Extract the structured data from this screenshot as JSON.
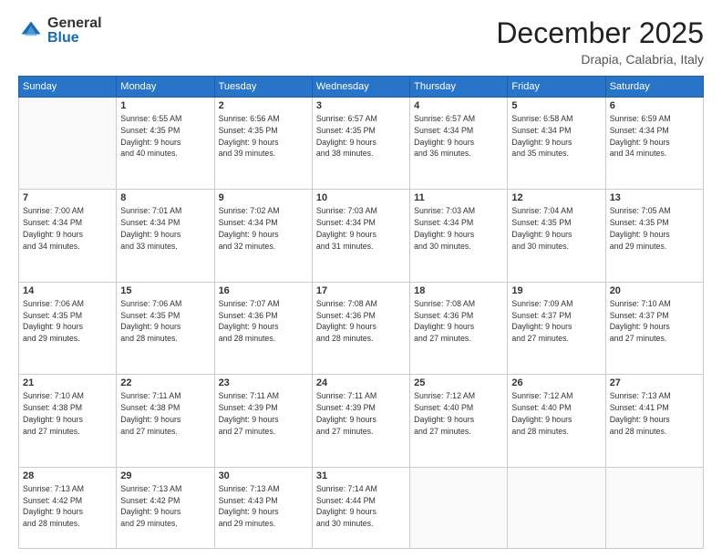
{
  "header": {
    "logo_general": "General",
    "logo_blue": "Blue",
    "month_title": "December 2025",
    "location": "Drapia, Calabria, Italy"
  },
  "days_of_week": [
    "Sunday",
    "Monday",
    "Tuesday",
    "Wednesday",
    "Thursday",
    "Friday",
    "Saturday"
  ],
  "weeks": [
    [
      {
        "day": "",
        "info": ""
      },
      {
        "day": "1",
        "info": "Sunrise: 6:55 AM\nSunset: 4:35 PM\nDaylight: 9 hours\nand 40 minutes."
      },
      {
        "day": "2",
        "info": "Sunrise: 6:56 AM\nSunset: 4:35 PM\nDaylight: 9 hours\nand 39 minutes."
      },
      {
        "day": "3",
        "info": "Sunrise: 6:57 AM\nSunset: 4:35 PM\nDaylight: 9 hours\nand 38 minutes."
      },
      {
        "day": "4",
        "info": "Sunrise: 6:57 AM\nSunset: 4:34 PM\nDaylight: 9 hours\nand 36 minutes."
      },
      {
        "day": "5",
        "info": "Sunrise: 6:58 AM\nSunset: 4:34 PM\nDaylight: 9 hours\nand 35 minutes."
      },
      {
        "day": "6",
        "info": "Sunrise: 6:59 AM\nSunset: 4:34 PM\nDaylight: 9 hours\nand 34 minutes."
      }
    ],
    [
      {
        "day": "7",
        "info": "Sunrise: 7:00 AM\nSunset: 4:34 PM\nDaylight: 9 hours\nand 34 minutes."
      },
      {
        "day": "8",
        "info": "Sunrise: 7:01 AM\nSunset: 4:34 PM\nDaylight: 9 hours\nand 33 minutes."
      },
      {
        "day": "9",
        "info": "Sunrise: 7:02 AM\nSunset: 4:34 PM\nDaylight: 9 hours\nand 32 minutes."
      },
      {
        "day": "10",
        "info": "Sunrise: 7:03 AM\nSunset: 4:34 PM\nDaylight: 9 hours\nand 31 minutes."
      },
      {
        "day": "11",
        "info": "Sunrise: 7:03 AM\nSunset: 4:34 PM\nDaylight: 9 hours\nand 30 minutes."
      },
      {
        "day": "12",
        "info": "Sunrise: 7:04 AM\nSunset: 4:35 PM\nDaylight: 9 hours\nand 30 minutes."
      },
      {
        "day": "13",
        "info": "Sunrise: 7:05 AM\nSunset: 4:35 PM\nDaylight: 9 hours\nand 29 minutes."
      }
    ],
    [
      {
        "day": "14",
        "info": "Sunrise: 7:06 AM\nSunset: 4:35 PM\nDaylight: 9 hours\nand 29 minutes."
      },
      {
        "day": "15",
        "info": "Sunrise: 7:06 AM\nSunset: 4:35 PM\nDaylight: 9 hours\nand 28 minutes."
      },
      {
        "day": "16",
        "info": "Sunrise: 7:07 AM\nSunset: 4:36 PM\nDaylight: 9 hours\nand 28 minutes."
      },
      {
        "day": "17",
        "info": "Sunrise: 7:08 AM\nSunset: 4:36 PM\nDaylight: 9 hours\nand 28 minutes."
      },
      {
        "day": "18",
        "info": "Sunrise: 7:08 AM\nSunset: 4:36 PM\nDaylight: 9 hours\nand 27 minutes."
      },
      {
        "day": "19",
        "info": "Sunrise: 7:09 AM\nSunset: 4:37 PM\nDaylight: 9 hours\nand 27 minutes."
      },
      {
        "day": "20",
        "info": "Sunrise: 7:10 AM\nSunset: 4:37 PM\nDaylight: 9 hours\nand 27 minutes."
      }
    ],
    [
      {
        "day": "21",
        "info": "Sunrise: 7:10 AM\nSunset: 4:38 PM\nDaylight: 9 hours\nand 27 minutes."
      },
      {
        "day": "22",
        "info": "Sunrise: 7:11 AM\nSunset: 4:38 PM\nDaylight: 9 hours\nand 27 minutes."
      },
      {
        "day": "23",
        "info": "Sunrise: 7:11 AM\nSunset: 4:39 PM\nDaylight: 9 hours\nand 27 minutes."
      },
      {
        "day": "24",
        "info": "Sunrise: 7:11 AM\nSunset: 4:39 PM\nDaylight: 9 hours\nand 27 minutes."
      },
      {
        "day": "25",
        "info": "Sunrise: 7:12 AM\nSunset: 4:40 PM\nDaylight: 9 hours\nand 27 minutes."
      },
      {
        "day": "26",
        "info": "Sunrise: 7:12 AM\nSunset: 4:40 PM\nDaylight: 9 hours\nand 28 minutes."
      },
      {
        "day": "27",
        "info": "Sunrise: 7:13 AM\nSunset: 4:41 PM\nDaylight: 9 hours\nand 28 minutes."
      }
    ],
    [
      {
        "day": "28",
        "info": "Sunrise: 7:13 AM\nSunset: 4:42 PM\nDaylight: 9 hours\nand 28 minutes."
      },
      {
        "day": "29",
        "info": "Sunrise: 7:13 AM\nSunset: 4:42 PM\nDaylight: 9 hours\nand 29 minutes."
      },
      {
        "day": "30",
        "info": "Sunrise: 7:13 AM\nSunset: 4:43 PM\nDaylight: 9 hours\nand 29 minutes."
      },
      {
        "day": "31",
        "info": "Sunrise: 7:14 AM\nSunset: 4:44 PM\nDaylight: 9 hours\nand 30 minutes."
      },
      {
        "day": "",
        "info": ""
      },
      {
        "day": "",
        "info": ""
      },
      {
        "day": "",
        "info": ""
      }
    ]
  ]
}
